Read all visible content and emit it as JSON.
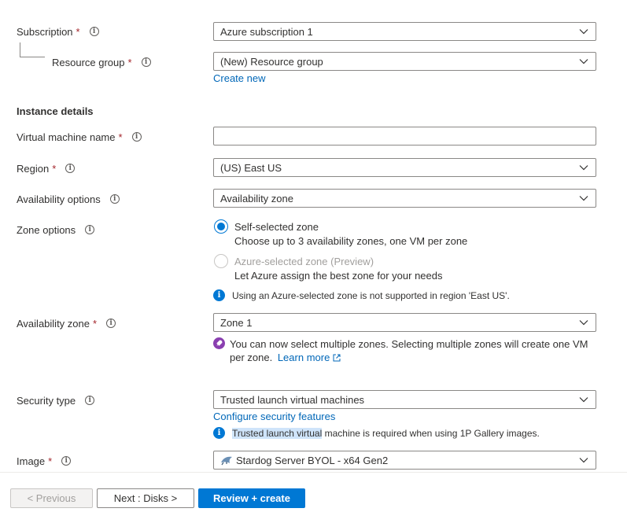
{
  "basics": {
    "subscription": {
      "label": "Subscription",
      "value": "Azure subscription 1"
    },
    "resource_group": {
      "label": "Resource group",
      "value": "(New) Resource group",
      "create_new": "Create new"
    }
  },
  "instance": {
    "heading": "Instance details",
    "vm_name": {
      "label": "Virtual machine name",
      "value": ""
    },
    "region": {
      "label": "Region",
      "value": "(US) East US"
    },
    "availability_options": {
      "label": "Availability options",
      "value": "Availability zone"
    },
    "zone_options": {
      "label": "Zone options",
      "self": {
        "title": "Self-selected zone",
        "desc": "Choose up to 3 availability zones, one VM per zone",
        "selected": true
      },
      "azure": {
        "title": "Azure-selected zone (Preview)",
        "desc": "Let Azure assign the best zone for your needs",
        "selected": false
      },
      "note": "Using an Azure-selected zone is not supported in region 'East US'."
    },
    "availability_zone": {
      "label": "Availability zone",
      "value": "Zone 1",
      "note_line1": "You can now select multiple zones. Selecting multiple zones will create one VM",
      "note_line2": "per zone.",
      "learn_more": "Learn more"
    },
    "security_type": {
      "label": "Security type",
      "value": "Trusted launch virtual machines",
      "configure_link": "Configure security features",
      "note_highlight": "Trusted launch virtual",
      "note_rest": " machine is required when using 1P Gallery images."
    },
    "image": {
      "label": "Image",
      "value": "Stardog Server BYOL - x64 Gen2"
    }
  },
  "footer": {
    "previous": "< Previous",
    "next": "Next : Disks >",
    "review": "Review + create"
  },
  "icons": {
    "info": "info-icon",
    "chevron": "chevron-down-icon",
    "rocket": "rocket-icon",
    "external": "external-link-icon",
    "image_logo": "stardog-logo-icon"
  },
  "colors": {
    "accent": "#0078d4",
    "link": "#0067b8",
    "required": "#a4262c",
    "highlight": "#cfe4fa",
    "rocket": "#8a3fb0"
  }
}
